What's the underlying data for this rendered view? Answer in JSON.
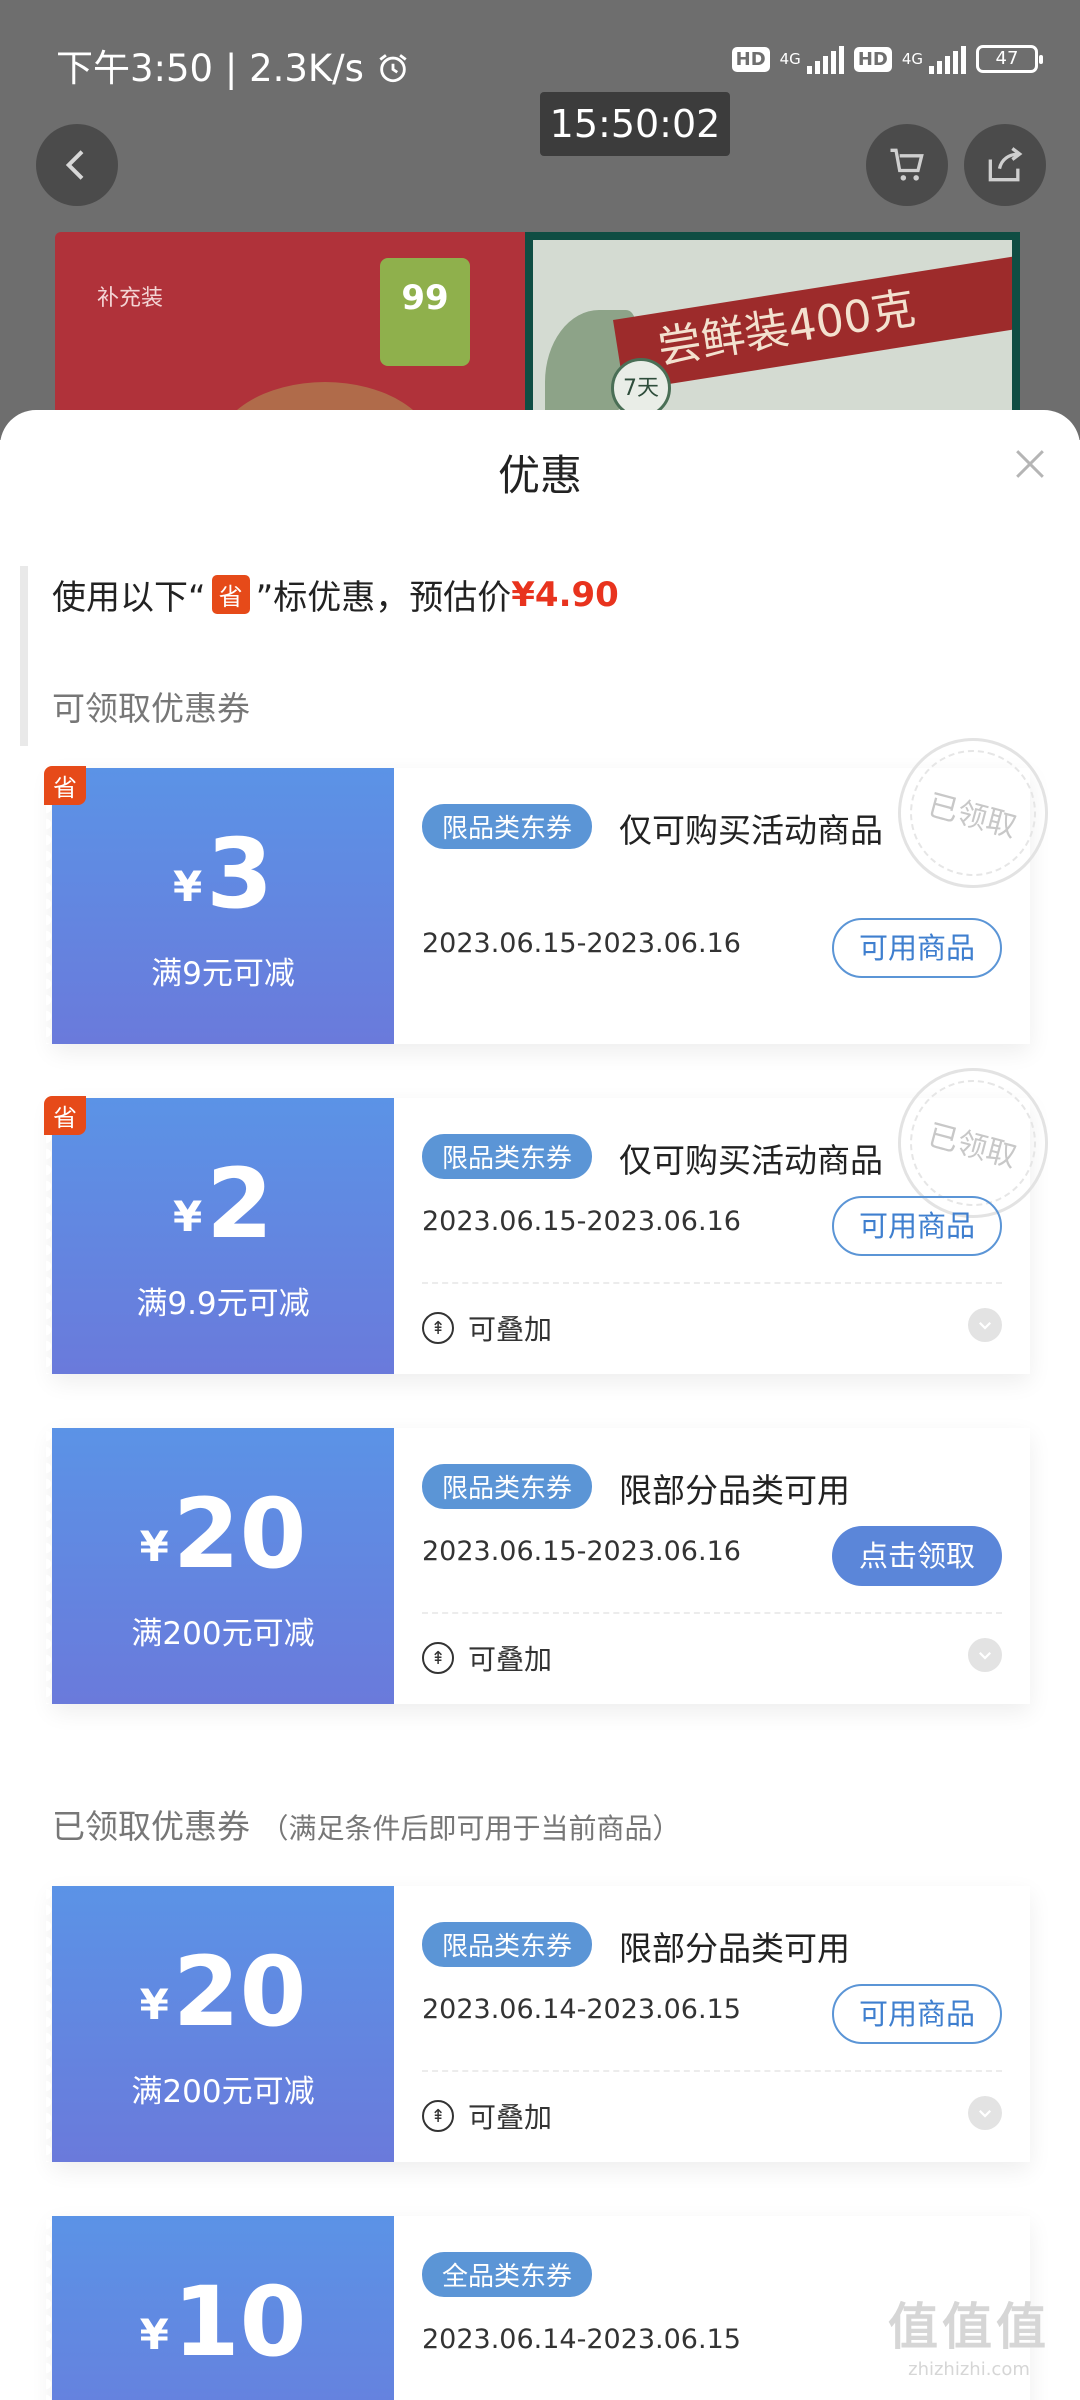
{
  "status_bar": {
    "left_text": "下午3:50 | 2.3K/s",
    "hd1": "HD",
    "net1": "4G",
    "hd2": "HD",
    "net2": "4G",
    "battery": "47"
  },
  "time_overlay": "15:50:02",
  "product": {
    "brand": "补充装",
    "badge": "99",
    "ribbon": "尝鲜装400克",
    "circle": "7天"
  },
  "sheet": {
    "title": "优惠",
    "hint_prefix": "使用以下“",
    "hint_tag": "省",
    "hint_suffix": "”标优惠，预估价",
    "hint_price": "¥4.90",
    "section1": "可领取优惠券",
    "section2": "已领取优惠券",
    "section2_note": "（满足条件后即可用于当前商品）"
  },
  "coupons": [
    {
      "corner": "省",
      "yen": "¥",
      "amount": "3",
      "condition": "满9元可减",
      "tag": "限品类东券",
      "desc": "仅可购买活动商品",
      "date": "2023.06.15-2023.06.16",
      "button": "可用商品",
      "stamp": "已领取"
    },
    {
      "corner": "省",
      "yen": "¥",
      "amount": "2",
      "condition": "满9.9元可减",
      "tag": "限品类东券",
      "desc": "仅可购买活动商品",
      "date": "2023.06.15-2023.06.16",
      "button": "可用商品",
      "stack": "可叠加",
      "stamp": "已领取"
    },
    {
      "yen": "¥",
      "amount": "20",
      "condition": "满200元可减",
      "tag": "限品类东券",
      "desc": "限部分品类可用",
      "date": "2023.06.15-2023.06.16",
      "button": "点击领取",
      "stack": "可叠加"
    },
    {
      "yen": "¥",
      "amount": "20",
      "condition": "满200元可减",
      "tag": "限品类东券",
      "desc": "限部分品类可用",
      "date": "2023.06.14-2023.06.15",
      "button": "可用商品",
      "stack": "可叠加"
    },
    {
      "yen": "¥",
      "amount": "10",
      "tag": "全品类东券",
      "date": "2023.06.14-2023.06.15"
    }
  ],
  "watermark": {
    "logo": "值值值",
    "url": "zhizhizhi.com"
  },
  "colors": {
    "coupon_gradient_top": "#5b93e6",
    "coupon_gradient_bottom": "#6a7adb",
    "price_red": "#e8331e",
    "tag_blue": "#5b95d6",
    "sheng_orange": "#e64a19"
  }
}
